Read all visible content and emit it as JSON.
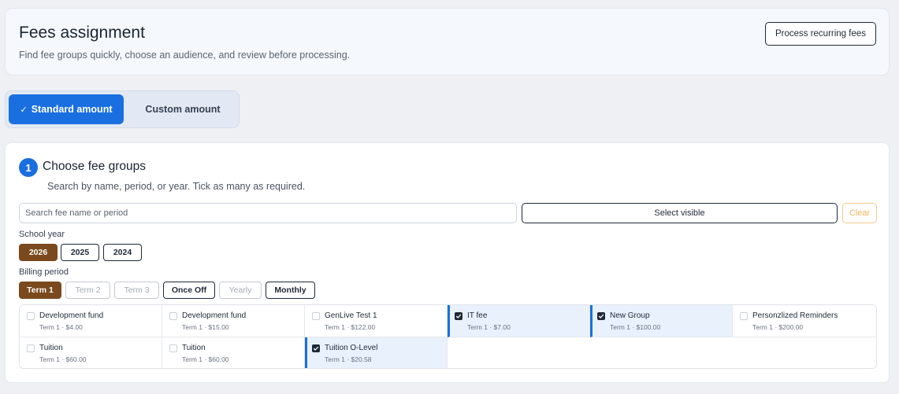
{
  "header": {
    "title": "Fees assignment",
    "subtitle": "Find fee groups quickly, choose an audience, and review before processing.",
    "process_label": "Process recurring fees"
  },
  "mode": {
    "check_icon": "✓",
    "standard_label": "Standard amount",
    "custom_label": "Custom amount",
    "selected": "standard"
  },
  "step": {
    "number": "1",
    "title": "Choose fee groups",
    "description": "Search by name, period, or year. Tick as many as required."
  },
  "search": {
    "placeholder": "Search fee name or period",
    "value": "",
    "select_visible_label": "Select visible",
    "clear_label": "Clear"
  },
  "school_year": {
    "label": "School year",
    "options": [
      "2026",
      "2025",
      "2024"
    ],
    "selected": "2026"
  },
  "billing_period": {
    "label": "Billing period",
    "options": [
      {
        "label": "Term 1",
        "state": "active"
      },
      {
        "label": "Term 2",
        "state": "disabled"
      },
      {
        "label": "Term 3",
        "state": "disabled"
      },
      {
        "label": "Once Off",
        "state": "enabled"
      },
      {
        "label": "Yearly",
        "state": "disabled"
      },
      {
        "label": "Monthly",
        "state": "enabled"
      }
    ]
  },
  "fee_groups": [
    {
      "name": "Development fund",
      "meta": "Term 1 · $4.00",
      "checked": false
    },
    {
      "name": "Development fund",
      "meta": "Term 1 · $15.00",
      "checked": false
    },
    {
      "name": "GenLive Test 1",
      "meta": "Term 1 · $122.00",
      "checked": false
    },
    {
      "name": "IT fee",
      "meta": "Term 1 · $7.00",
      "checked": true
    },
    {
      "name": "New Group",
      "meta": "Term 1 · $100.00",
      "checked": true
    },
    {
      "name": "Personzlized Reminders",
      "meta": "Term 1 · $200.00",
      "checked": false
    },
    {
      "name": "Tuition",
      "meta": "Term 1 · $60.00",
      "checked": false
    },
    {
      "name": "Tuition",
      "meta": "Term 1 · $60.00",
      "checked": false
    },
    {
      "name": "Tuition O-Level",
      "meta": "Term 1 · $20.58",
      "checked": true
    }
  ],
  "colors": {
    "accent": "#1a6fe0",
    "chip_active": "#7a4a1e",
    "clear_warning": "#f0b55e"
  }
}
